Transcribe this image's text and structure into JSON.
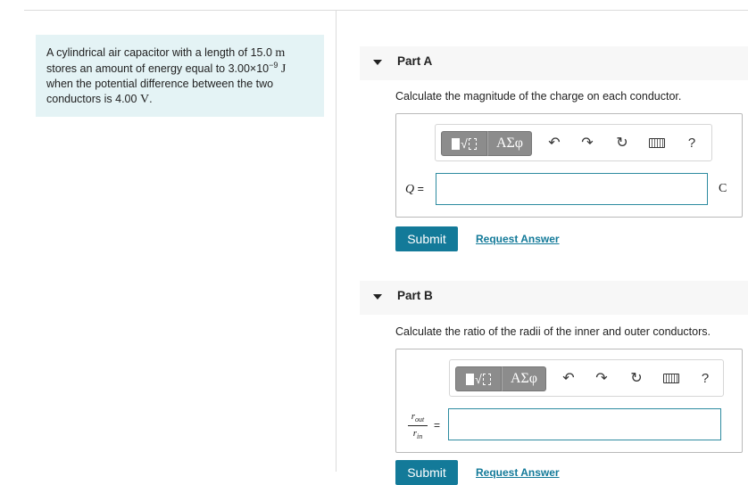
{
  "problem": {
    "text_1": "A cylindrical air capacitor with a length of 15.0",
    "unit_m": "m",
    "text_2": "stores an amount of energy equal to 3.00×10",
    "exponent": "−9",
    "unit_J": "J",
    "text_3": "when the potential difference between the two",
    "text_4": "conductors is 4.00",
    "unit_V": "V",
    "text_end": "."
  },
  "part_a": {
    "title": "Part A",
    "question": "Calculate the magnitude of the charge on each conductor.",
    "toolbar": {
      "greek_label": "ΑΣφ",
      "help_label": "?"
    },
    "var_label": "Q",
    "equals": "=",
    "input_value": "",
    "unit": "C",
    "submit_label": "Submit",
    "request_label": "Request Answer"
  },
  "part_b": {
    "title": "Part B",
    "question": "Calculate the ratio of the radii of the inner and outer conductors.",
    "toolbar": {
      "greek_label": "ΑΣφ",
      "help_label": "?"
    },
    "ratio_num": "r",
    "ratio_num_sub": "out",
    "ratio_den": "r",
    "ratio_den_sub": "in",
    "equals": "=",
    "input_value": "",
    "submit_label": "Submit",
    "request_label": "Request Answer"
  },
  "icons": [
    "collapse-triangle-icon",
    "template-icon",
    "greek-symbols-icon",
    "undo-icon",
    "redo-icon",
    "reset-icon",
    "keyboard-icon",
    "help-icon"
  ]
}
